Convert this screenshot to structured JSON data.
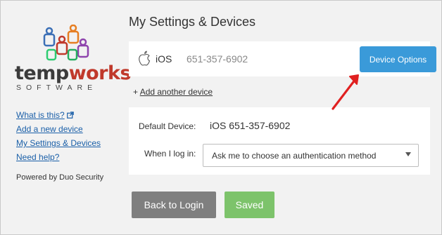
{
  "sidebar": {
    "logo": {
      "word_dark": "temp",
      "word_red": "works",
      "subtitle": "SOFTWARE"
    },
    "links": [
      {
        "label": "What is this?",
        "icon": "external-link-icon"
      },
      {
        "label": "Add a new device"
      },
      {
        "label": "My Settings & Devices"
      },
      {
        "label": "Need help?"
      }
    ],
    "powered_by": "Powered by Duo Security"
  },
  "main": {
    "title": "My Settings & Devices",
    "device": {
      "icon": "apple-icon",
      "os": "iOS",
      "phone": "651-357-6902",
      "options_label": "Device Options"
    },
    "add_device": {
      "prefix": "+ ",
      "label": "Add another device"
    },
    "settings": {
      "default_device_label": "Default Device:",
      "default_device_value": "iOS 651-357-6902",
      "login_label": "When I log in:",
      "login_selected": "Ask me to choose an authentication method"
    },
    "buttons": {
      "back": "Back to Login",
      "saved": "Saved"
    }
  },
  "colors": {
    "accent_blue": "#3a9ad9",
    "saved_green": "#7dc36b",
    "back_gray": "#7f7f7f",
    "link_blue": "#1a5fa8",
    "annotation_red": "#e02020",
    "brand_red": "#c0392b"
  }
}
